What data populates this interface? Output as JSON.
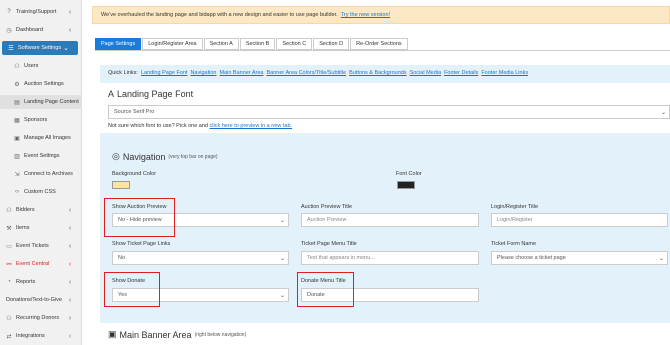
{
  "sidebar": {
    "items": [
      {
        "label": "Training/Support",
        "icon": "question-icon"
      },
      {
        "label": "Dashboard",
        "icon": "dashboard-icon"
      },
      {
        "label": "Software Settings",
        "icon": "settings-icon"
      },
      {
        "label": "Users",
        "icon": "users-icon"
      },
      {
        "label": "Auction Settings",
        "icon": "gear-icon"
      },
      {
        "label": "Landing Page Content",
        "icon": "page-icon"
      },
      {
        "label": "Sponsors",
        "icon": "sponsors-icon"
      },
      {
        "label": "Manage All Images",
        "icon": "image-icon"
      },
      {
        "label": "Event Settings",
        "icon": "event-icon"
      },
      {
        "label": "Connect to Archives",
        "icon": "archive-icon"
      },
      {
        "label": "Custom CSS",
        "icon": "code-icon"
      },
      {
        "label": "Bidders",
        "icon": "bidders-icon"
      },
      {
        "label": "Items",
        "icon": "gavel-icon"
      },
      {
        "label": "Event Tickets",
        "icon": "ticket-icon"
      },
      {
        "label": "Event Central",
        "icon": "central-icon"
      },
      {
        "label": "Reports",
        "icon": "reports-icon"
      },
      {
        "label": "Donations/Text-to-Give",
        "icon": "donation-icon"
      },
      {
        "label": "Recurring Donors",
        "icon": "recurring-icon"
      },
      {
        "label": "Integrations",
        "icon": "integrations-icon"
      }
    ]
  },
  "banner": {
    "text": "We've overhauled the landing page and bidapp with a new design and easier to use page builder.",
    "link": "Try the new version!"
  },
  "tabs": [
    "Page Settings",
    "Login/Register Area",
    "Section A",
    "Section B",
    "Section C",
    "Section D",
    "Re-Order Sections"
  ],
  "quick_links": {
    "label": "Quick Links:",
    "links": [
      "Landing Page Font",
      "Navigation",
      "Main Banner Area",
      "Banner Area Colors/Title/Subtitle",
      "Buttons & Backgrounds",
      "Social Media",
      "Footer Details",
      "Footer Media Links"
    ]
  },
  "landing_font": {
    "title": "Landing Page Font",
    "value": "Source Serif Pro",
    "note": "Not sure which font to use? Pick one and",
    "note_link": "click here to preview in a new tab."
  },
  "navigation": {
    "title": "Navigation",
    "subtitle": "(very top bar on page)",
    "bg_color_label": "Background Color",
    "bg_color": "#fde59a",
    "font_color_label": "Font Color",
    "font_color": "#222222",
    "show_auction_preview_label": "Show Auction Preview",
    "show_auction_preview_value": "No - Hide preview",
    "auction_preview_title_label": "Auction Preview Title",
    "auction_preview_title_placeholder": "Auction Preview",
    "login_register_title_label": "Login/Register Title",
    "login_register_title_placeholder": "Login/Register",
    "show_ticket_links_label": "Show Ticket Page Links",
    "show_ticket_links_value": "No",
    "ticket_menu_title_label": "Ticket Page Menu Title",
    "ticket_menu_title_placeholder": "Text that appears in menu...",
    "ticket_form_name_label": "Ticket Form Name",
    "ticket_form_name_value": "Please choose a ticket page",
    "show_donate_label": "Show Donate",
    "show_donate_value": "Yes",
    "donate_menu_title_label": "Donate Menu Title",
    "donate_menu_title_value": "Donate"
  },
  "main_banner": {
    "title": "Main Banner Area",
    "subtitle": "(right below navigation)"
  },
  "colors": {
    "accent": "#2b7bb9",
    "highlight": "#e02020",
    "panel": "#e3f1fa"
  }
}
